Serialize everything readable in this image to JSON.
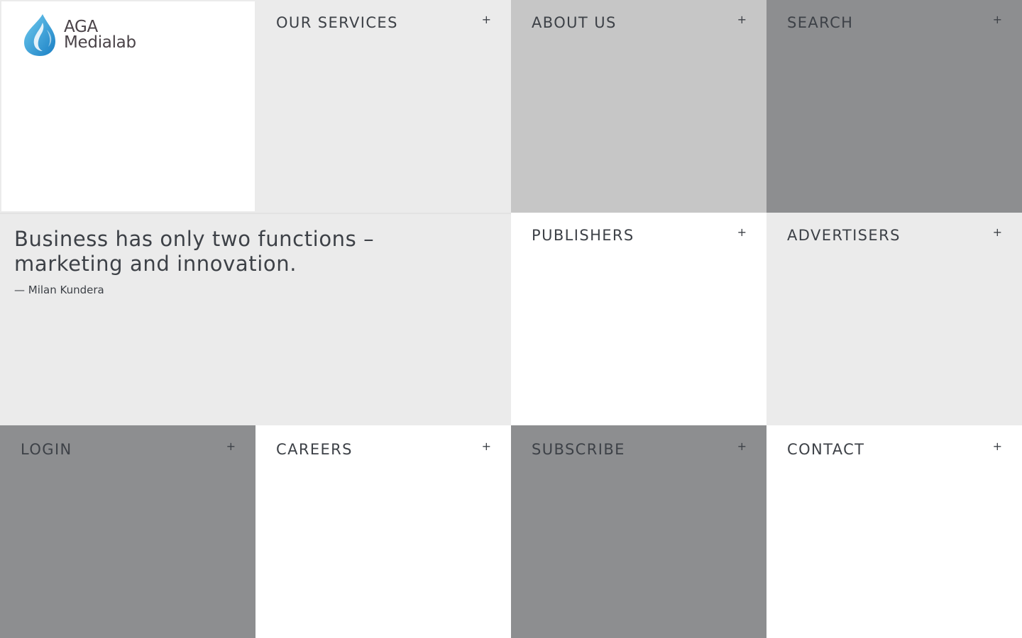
{
  "brand": {
    "line1": "AGA",
    "line2": "Medialab",
    "logo_icon": "water-drop-icon"
  },
  "tiles": {
    "services": {
      "label": "OUR SERVICES",
      "plus": "+"
    },
    "about": {
      "label": "ABOUT US",
      "plus": "+"
    },
    "search": {
      "label": "SEARCH",
      "plus": "+"
    },
    "publishers": {
      "label": "PUBLISHERS",
      "plus": "+"
    },
    "advertisers": {
      "label": "ADVERTISERS",
      "plus": "+"
    },
    "login": {
      "label": "LOGIN",
      "plus": "+"
    },
    "careers": {
      "label": "CAREERS",
      "plus": "+"
    },
    "subscribe": {
      "label": "SUBSCRIBE",
      "plus": "+"
    },
    "contact": {
      "label": "CONTACT",
      "plus": "+"
    }
  },
  "quote": {
    "text": "Business has only two functions – marketing and innovation.",
    "author": "— Milan Kundera"
  },
  "colors": {
    "white": "#ffffff",
    "light_gray": "#ebebeb",
    "mid_gray": "#c6c6c6",
    "dark_gray": "#8d8e90",
    "text": "#3d4147",
    "brand_blue": "#2a9fd8"
  }
}
